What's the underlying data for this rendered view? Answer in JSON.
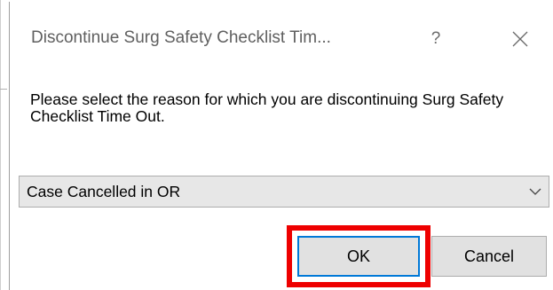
{
  "dialog": {
    "title": "Discontinue Surg Safety Checklist Tim...",
    "help_label": "?",
    "close_icon": "close-icon",
    "prompt": "Please select the reason for which you are discontinuing Surg Safety Checklist Time Out.",
    "reason": {
      "selected": "Case Cancelled in OR",
      "arrow_icon": "chevron-down-icon"
    },
    "buttons": {
      "ok_label": "OK",
      "cancel_label": "Cancel"
    }
  },
  "colors": {
    "highlight": "#ee0000",
    "focus_border": "#0078d7",
    "button_bg": "#e1e1e1",
    "combo_bg": "#e7e7e7"
  }
}
